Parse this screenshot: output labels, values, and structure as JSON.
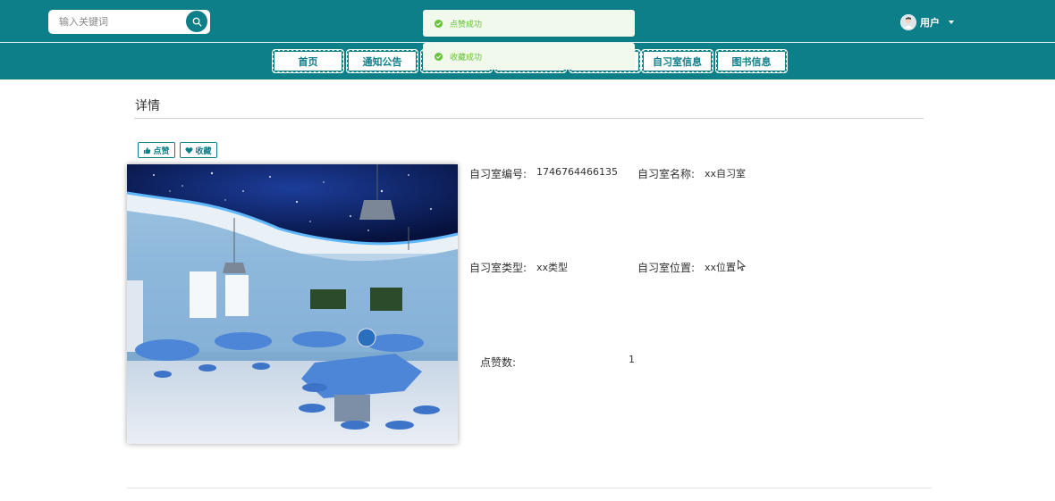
{
  "header": {
    "search_placeholder": "输入关键词",
    "user_label": "用户"
  },
  "nav": {
    "items": [
      {
        "label": "首页"
      },
      {
        "label": "通知公告"
      },
      {
        "label": ""
      },
      {
        "label": ""
      },
      {
        "label": ""
      },
      {
        "label": "自习室信息"
      },
      {
        "label": "图书信息"
      }
    ]
  },
  "toasts": [
    {
      "text": "点赞成功"
    },
    {
      "text": "收藏成功"
    }
  ],
  "detail": {
    "title": "详情",
    "like_label": "点赞",
    "favorite_label": "收藏",
    "fields": {
      "room_no_label": "自习室编号:",
      "room_no_value": "1746764466135",
      "room_name_label": "自习室名称:",
      "room_name_value": "xx自习室",
      "room_type_label": "自习室类型:",
      "room_type_value": "xx类型",
      "room_location_label": "自习室位置:",
      "room_location_value": "xx位置",
      "likes_label": "点赞数:",
      "likes_value": "1"
    }
  },
  "colors": {
    "primary": "#0d7f88",
    "success": "#67c23a",
    "success_bg": "#f0f9eb"
  }
}
